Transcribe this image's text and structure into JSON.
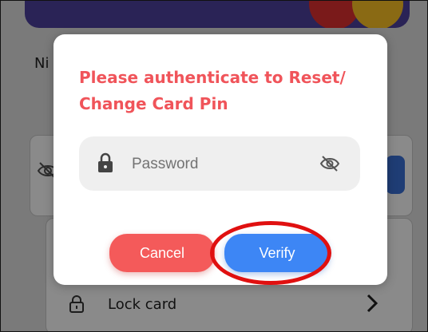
{
  "background": {
    "nickname_label_partial": "Ni",
    "lock_card_label": "Lock card"
  },
  "dialog": {
    "title": "Please authenticate to Reset/ Change Card Pin",
    "password": {
      "placeholder": "Password",
      "value": ""
    },
    "cancel_label": "Cancel",
    "verify_label": "Verify"
  },
  "icons": {
    "lock": "lock-icon",
    "eye_off": "eye-off-icon",
    "chevron": "chevron-right-icon"
  },
  "colors": {
    "title_red": "#f0545a",
    "cancel_red": "#f45a5a",
    "verify_blue": "#3d86f5",
    "annotation_red": "#e01010",
    "overlay_gray": "#7a7a7a"
  }
}
